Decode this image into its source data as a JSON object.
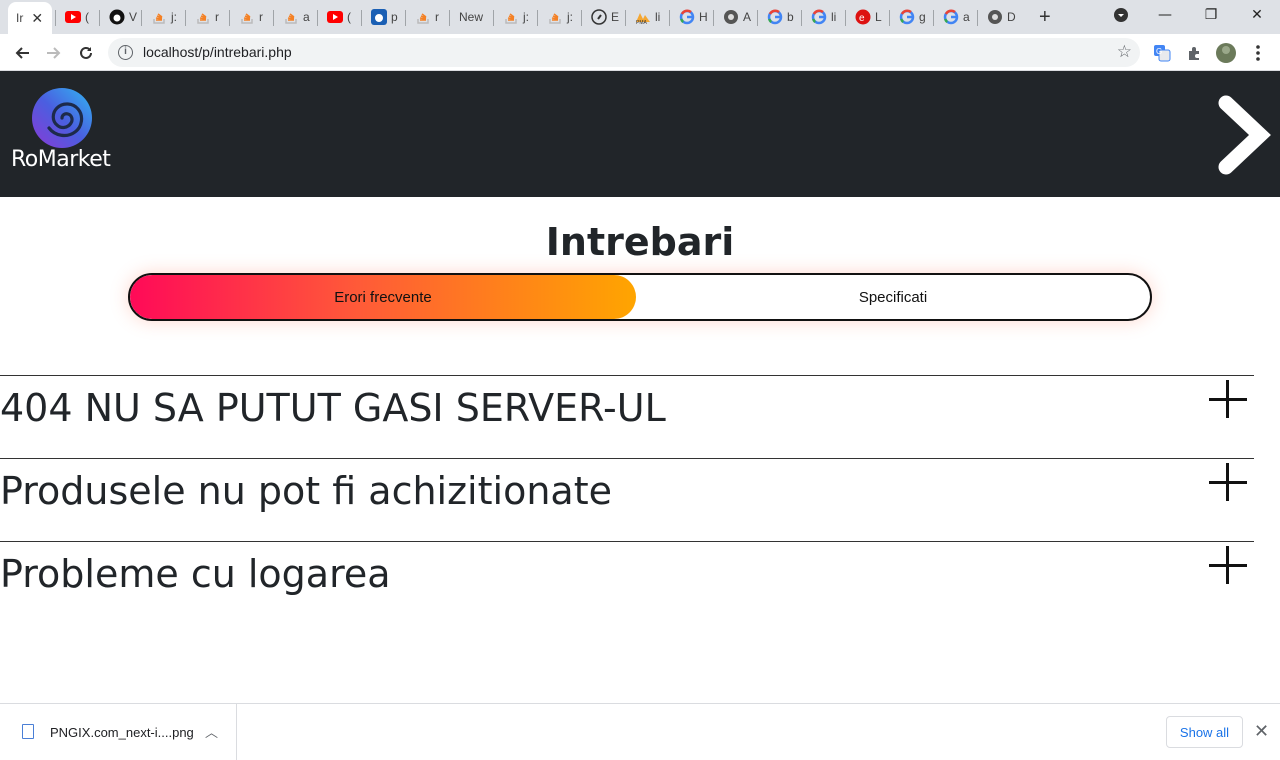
{
  "browser": {
    "tabs": [
      {
        "label": "Ir",
        "icon": "page-icon",
        "active": true
      },
      {
        "label": "(",
        "icon": "youtube-icon"
      },
      {
        "label": "V",
        "icon": "github-icon"
      },
      {
        "label": "j:",
        "icon": "stackoverflow-icon"
      },
      {
        "label": "r",
        "icon": "stackoverflow-icon"
      },
      {
        "label": "r",
        "icon": "stackoverflow-icon"
      },
      {
        "label": "a",
        "icon": "stackoverflow-icon"
      },
      {
        "label": "(",
        "icon": "youtube-icon"
      },
      {
        "label": "p",
        "icon": "site-icon"
      },
      {
        "label": "r",
        "icon": "stackoverflow-icon"
      },
      {
        "label": "New",
        "icon": ""
      },
      {
        "label": "j:",
        "icon": "stackoverflow-icon"
      },
      {
        "label": "j:",
        "icon": "stackoverflow-icon"
      },
      {
        "label": "E",
        "icon": "compass-icon"
      },
      {
        "label": "li",
        "icon": "pma-icon"
      },
      {
        "label": "H",
        "icon": "google-icon"
      },
      {
        "label": "A",
        "icon": "globe-icon"
      },
      {
        "label": "b",
        "icon": "google-icon"
      },
      {
        "label": "li",
        "icon": "google-icon"
      },
      {
        "label": "L",
        "icon": "red-e-icon"
      },
      {
        "label": "g",
        "icon": "google-icon"
      },
      {
        "label": "a",
        "icon": "google-icon"
      },
      {
        "label": "D",
        "icon": "globe-icon"
      }
    ],
    "new_tab": "+",
    "url": "localhost/p/intrebari.php"
  },
  "header": {
    "brand": "RoMarket"
  },
  "page": {
    "title": "Intrebari",
    "toggle": {
      "selected": "Erori frecvente",
      "other": "Specificati"
    },
    "faq": [
      {
        "question": "404 NU SA PUTUT GASI SERVER-UL"
      },
      {
        "question": "Produsele nu pot fi achizitionate"
      },
      {
        "question": "Probleme cu logarea"
      }
    ]
  },
  "downloads": {
    "file": "PNGIX.com_next-i....png",
    "show_all": "Show all"
  },
  "colors": {
    "header_bg": "#212529",
    "gradient_start": "#ff0a58",
    "gradient_end": "#ffa500",
    "chrome_link": "#1a73e8"
  }
}
